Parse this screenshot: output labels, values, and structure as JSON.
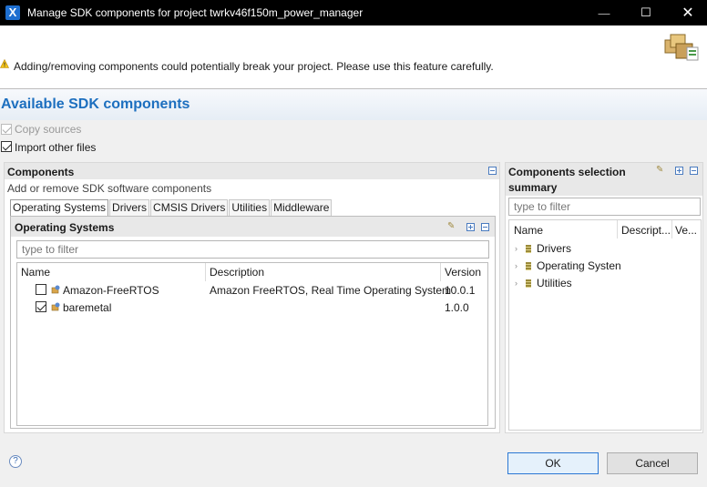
{
  "window": {
    "title": "Manage SDK components for project twrkv46f150m_power_manager",
    "minimize": "—",
    "maximize": "☐",
    "close": "✕"
  },
  "header": {
    "warning": "Adding/removing components could potentially break your project. Please use this feature carefully."
  },
  "page_title": "Available SDK components",
  "options": {
    "copy_sources": "Copy sources",
    "import_other_files": "Import other files"
  },
  "components": {
    "title": "Components",
    "description": "Add or remove SDK software components",
    "tabs": [
      "Operating Systems",
      "Drivers",
      "CMSIS Drivers",
      "Utilities",
      "Middleware"
    ],
    "section_title": "Operating Systems",
    "filter_placeholder": "type to filter",
    "columns": {
      "name": "Name",
      "description": "Description",
      "version": "Version"
    },
    "rows": [
      {
        "name": "Amazon-FreeRTOS",
        "description": "Amazon FreeRTOS, Real Time Operating System",
        "version": "10.0.1",
        "checked": false
      },
      {
        "name": "baremetal",
        "description": "",
        "version": "1.0.0",
        "checked": true
      }
    ]
  },
  "summary": {
    "title": "Components selection summary",
    "filter_placeholder": "type to filter",
    "columns": {
      "name": "Name",
      "description": "Descript...",
      "version": "Ve..."
    },
    "items": [
      "Drivers",
      "Operating Systen",
      "Utilities"
    ]
  },
  "footer": {
    "help": "?",
    "ok": "OK",
    "cancel": "Cancel"
  }
}
